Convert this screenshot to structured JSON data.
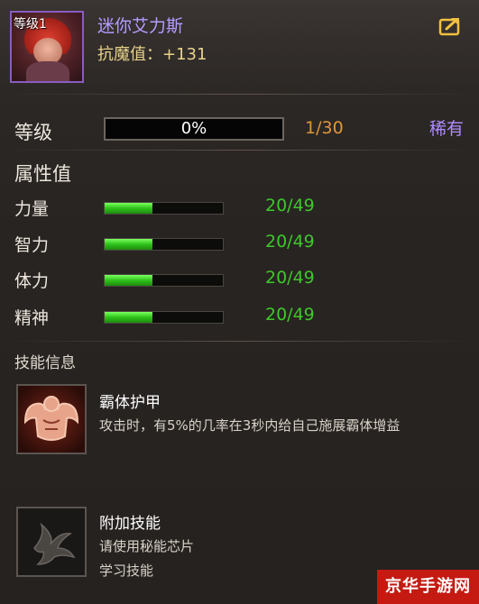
{
  "header": {
    "level_tag": "等级1",
    "pet_name": "迷你艾力斯",
    "resist_label": "抗魔值：",
    "resist_value": "+131",
    "export_icon": "share-arrow-icon"
  },
  "progress": {
    "label": "等级",
    "percent_text": "0%",
    "percent": 0,
    "count": "1/30",
    "rarity": "稀有"
  },
  "attributes": {
    "title": "属性值",
    "items": [
      {
        "label": "力量",
        "value": "20/49",
        "fill": 0.408
      },
      {
        "label": "智力",
        "value": "20/49",
        "fill": 0.408
      },
      {
        "label": "体力",
        "value": "20/49",
        "fill": 0.408
      },
      {
        "label": "精神",
        "value": "20/49",
        "fill": 0.408
      }
    ]
  },
  "skills": {
    "title": "技能信息",
    "items": [
      {
        "name": "霸体护甲",
        "desc_lines": [
          "攻击时，有5%的几率在3秒内给自己施展霸体增益"
        ],
        "icon": "muscle-armor-icon"
      },
      {
        "name": "附加技能",
        "desc_lines": [
          "请使用秘能芯片",
          "学习技能"
        ],
        "icon": "locked-skill-icon"
      }
    ]
  },
  "watermark": "京华手游网",
  "colors": {
    "name_purple": "#b59cff",
    "resist_gold": "#e8d28a",
    "count_orange": "#e0953a",
    "rarity_purple": "#b08cff",
    "bar_green": "#2fc21a",
    "value_green": "#3ec82a"
  }
}
